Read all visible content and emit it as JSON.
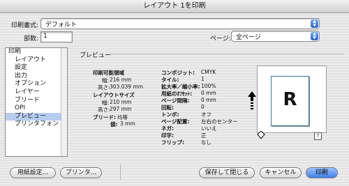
{
  "window": {
    "title": "レイアウト 1を印刷"
  },
  "top": {
    "print_style_label": "印刷書式:",
    "print_style_value": "デフォルト",
    "copies_label": "部数:",
    "copies_value": "1",
    "pages_label": "ページ:",
    "pages_value": "全ページ"
  },
  "sidebar": {
    "items": [
      {
        "label": "印刷"
      },
      {
        "label": "レイアウト"
      },
      {
        "label": "設定"
      },
      {
        "label": "出力"
      },
      {
        "label": "オプション"
      },
      {
        "label": "レイヤー"
      },
      {
        "label": "ブリード"
      },
      {
        "label": "OPI"
      },
      {
        "label": "プレビュー"
      },
      {
        "label": "プリンタフォント"
      }
    ]
  },
  "preview": {
    "section_title": "プレビュー",
    "printable_area_label": "印刷可能領域",
    "pa_width_label": "幅:",
    "pa_width_value": "216 mm",
    "pa_height_label": "高さ:",
    "pa_height_value": "303.039 mm",
    "layout_size_label": "レイアウトサイズ",
    "ls_width_label": "幅:",
    "ls_width_value": "210 mm",
    "ls_height_label": "高さ:",
    "ls_height_value": "297 mm",
    "bleed_label": "ブリード:",
    "bleed_value": "均等",
    "bleed_amount_label": "値:",
    "bleed_amount_value": "3 mm",
    "composite_label": "コンポジット:",
    "composite_value": "CMYK",
    "tile_label": "タイル:",
    "tile_value": "1",
    "scale_label": "拡大率／縮小率:",
    "scale_value": "100%",
    "paper_offset_label": "用紙のｵﾌｾｯﾄ:",
    "paper_offset_value": "0 mm",
    "page_gap_label": "ページ間隔:",
    "page_gap_value": "0 mm",
    "rotation_label": "回転:",
    "rotation_value": "0",
    "crop_marks_label": "トンボ:",
    "crop_marks_value": "オフ",
    "page_placement_label": "ページ配置:",
    "page_placement_value": "左右のセンター",
    "negative_label": "ネガ:",
    "negative_value": "いいえ",
    "print_label": "印字:",
    "print_value": "正",
    "flip_label": "フリップ:",
    "flip_value": "なし",
    "page_letter": "R",
    "help_icon_text": "?"
  },
  "buttons": {
    "paper_setup": "用紙設定...",
    "printer": "プリンタ...",
    "save_close": "保存して閉じる",
    "cancel": "キャンセル",
    "print": "印刷"
  }
}
